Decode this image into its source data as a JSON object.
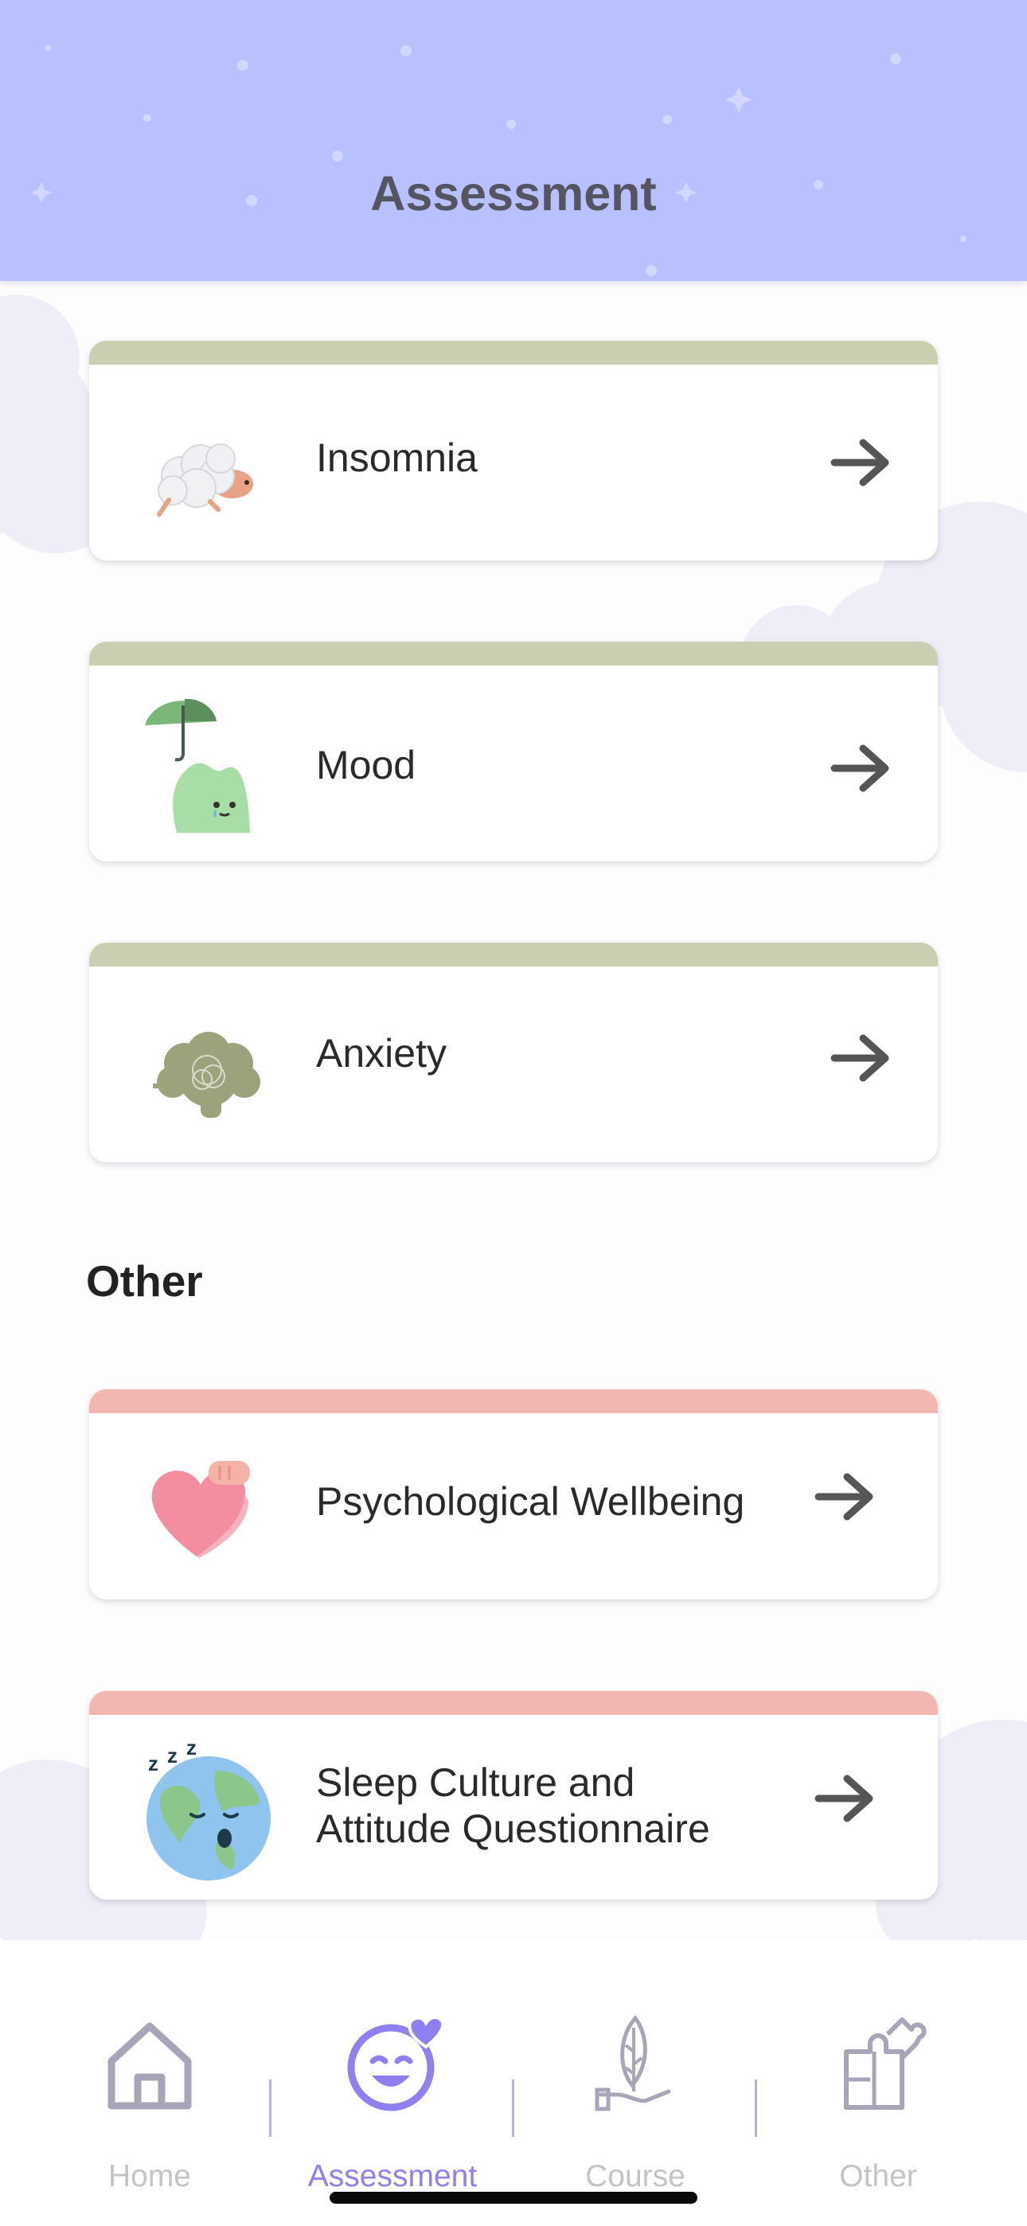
{
  "header": {
    "title": "Assessment"
  },
  "cards": [
    {
      "label": "Insomnia",
      "icon": "sheep-icon",
      "accent": "#c9cfb1"
    },
    {
      "label": "Mood",
      "icon": "umbrella-hill-icon",
      "accent": "#c9cfb1"
    },
    {
      "label": "Anxiety",
      "icon": "tangled-brain-icon",
      "accent": "#c9cfb1"
    },
    {
      "label": "Psychological Wellbeing",
      "icon": "heart-icon",
      "accent": "#f2b7b0"
    },
    {
      "label": "Sleep Culture and\nAttitude Questionnaire",
      "icon": "sleeping-earth-icon",
      "accent": "#f2b7b0"
    }
  ],
  "sections": {
    "other_title": "Other"
  },
  "tabbar": {
    "active": "Assessment",
    "active_color": "#8f80f0",
    "tabs": [
      {
        "label": "Home",
        "icon": "house-icon"
      },
      {
        "label": "Assessment",
        "icon": "smiley-heart-icon"
      },
      {
        "label": "Course",
        "icon": "leaf-hand-icon"
      },
      {
        "label": "Other",
        "icon": "puzzle-icon"
      }
    ]
  },
  "colors": {
    "header_bg": "#b8c0fd",
    "arrow": "#555555"
  }
}
